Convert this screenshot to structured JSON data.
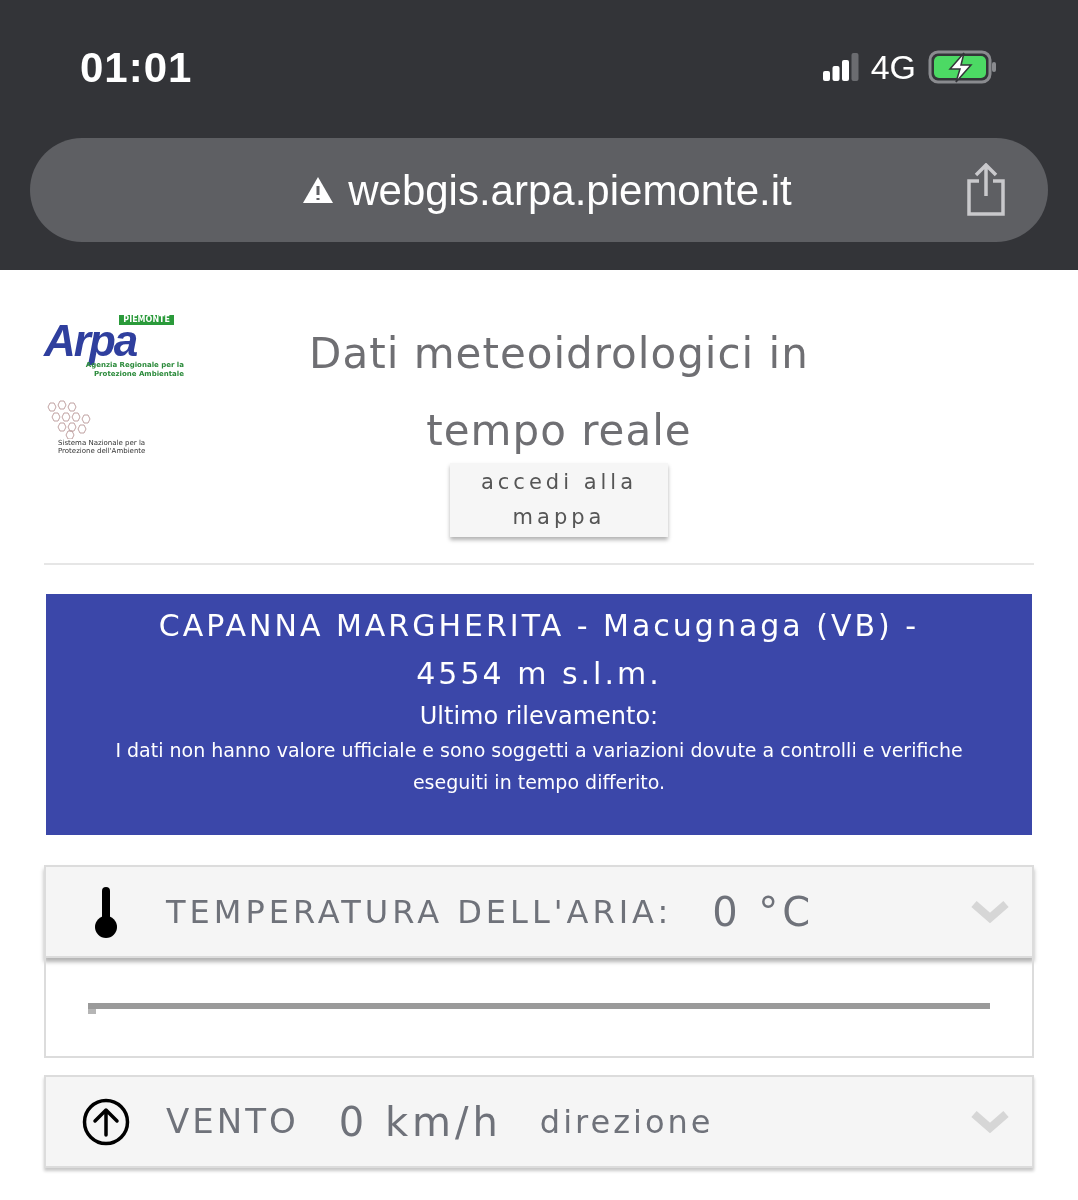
{
  "status_bar": {
    "time": "01:01",
    "network": "4G"
  },
  "address_bar": {
    "url": "webgis.arpa.piemonte.it"
  },
  "logos": {
    "arpa": {
      "region": "PIEMONTE",
      "name": "Arpa",
      "subtitle": "Agenzia Regionale per la Protezione Ambientale"
    },
    "snpa": {
      "text": "Sistema Nazionale per la Protezione dell'Ambiente"
    }
  },
  "header": {
    "title": "Dati meteoidrologici in tempo reale",
    "map_button": "accedi alla mappa"
  },
  "station": {
    "title": "CAPANNA MARGHERITA - Macugnaga (VB) - 4554 m s.l.m.",
    "subtitle": "Ultimo rilevamento:",
    "note": "I dati non hanno valore ufficiale e sono soggetti a variazioni dovute a controlli e verifiche eseguiti in tempo differito."
  },
  "sections": [
    {
      "kind": "temperature",
      "label": "TEMPERATURA DELL'ARIA:",
      "value": "0 °C",
      "expanded": true
    },
    {
      "kind": "wind",
      "label": "VENTO",
      "value": "0 km/h",
      "extra": "direzione",
      "expanded": false
    }
  ]
}
